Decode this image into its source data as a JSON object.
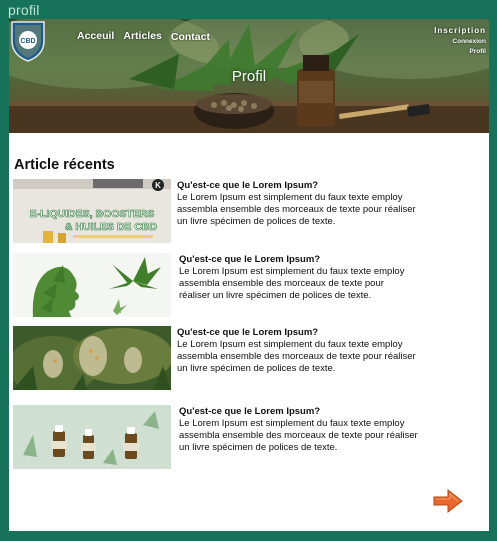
{
  "window": {
    "title": "profil"
  },
  "header": {
    "logo_text": "CBD",
    "nav": [
      "Acceuil",
      "Articles",
      "Contact"
    ],
    "auth": {
      "inscription": "Inscription",
      "connexion": "Connexion",
      "profil": "Profil"
    },
    "banner_title": "Profil"
  },
  "main": {
    "section_title": "Article récents",
    "articles": [
      {
        "title": "Qu'est-ce que le Lorem Ipsum?",
        "body": "Le Lorem Ipsum est simplement du faux texte employ\n assembla ensemble des morceaux de texte pour réaliser\nun livre spécimen de polices de texte.",
        "thumb_text_1": "E-LIQUIDES, BOOSTERS",
        "thumb_text_2": "& HUILES DE CBD",
        "thumb_tag": "K"
      },
      {
        "title": "Qu'est-ce que le Lorem Ipsum?",
        "body": "Le Lorem Ipsum est simplement du faux texte employ\n assembla ensemble des morceaux de texte pour\nréaliser un livre spécimen de polices de texte."
      },
      {
        "title": "Qu'est-ce que le Lorem Ipsum?",
        "body": "Le Lorem Ipsum est simplement du faux texte employ\n assembla ensemble des morceaux de texte pour réaliser\nun livre spécimen de polices de texte."
      },
      {
        "title": "Qu'est-ce que le Lorem Ipsum?",
        "body": "Le Lorem Ipsum est simplement du faux texte employ\n assembla ensemble des morceaux de texte pour réaliser\nun livre spécimen de polices de texte."
      }
    ]
  },
  "colors": {
    "frame": "#16735a",
    "arrow": "#e9672a"
  },
  "icons": {
    "next": "next-arrow-icon",
    "logo": "cbd-shield-logo"
  }
}
